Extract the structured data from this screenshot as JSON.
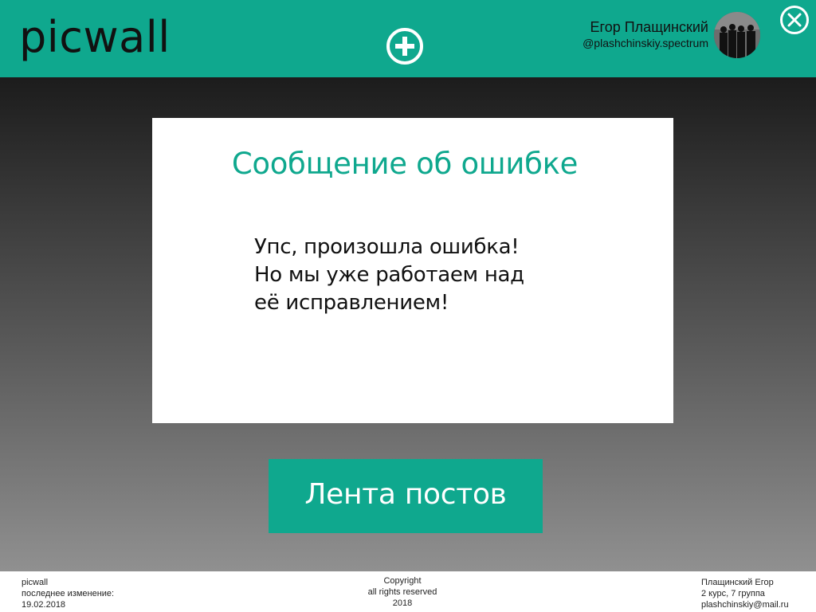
{
  "header": {
    "logo": "picwall",
    "user_name": "Егор Плащинский",
    "user_handle": "@plashchinskiy.spectrum",
    "add_icon": "plus-circle-icon",
    "close_icon": "close-circle-icon",
    "accent_color": "#0fa88e"
  },
  "error_card": {
    "title": "Сообщение об ошибке",
    "lines": [
      "Упс, произошла ошибка!",
      "Но мы уже работаем над",
      "её исправлением!"
    ]
  },
  "feed_button": {
    "label": "Лента постов"
  },
  "footer": {
    "left": [
      "picwall",
      "последнее изменение:",
      "19.02.2018"
    ],
    "center": [
      "Copyright",
      "all rights reserved",
      "2018"
    ],
    "right": [
      "Плащинский Егор",
      "2 курс, 7 группа",
      "plashchinskiy@mail.ru"
    ]
  }
}
